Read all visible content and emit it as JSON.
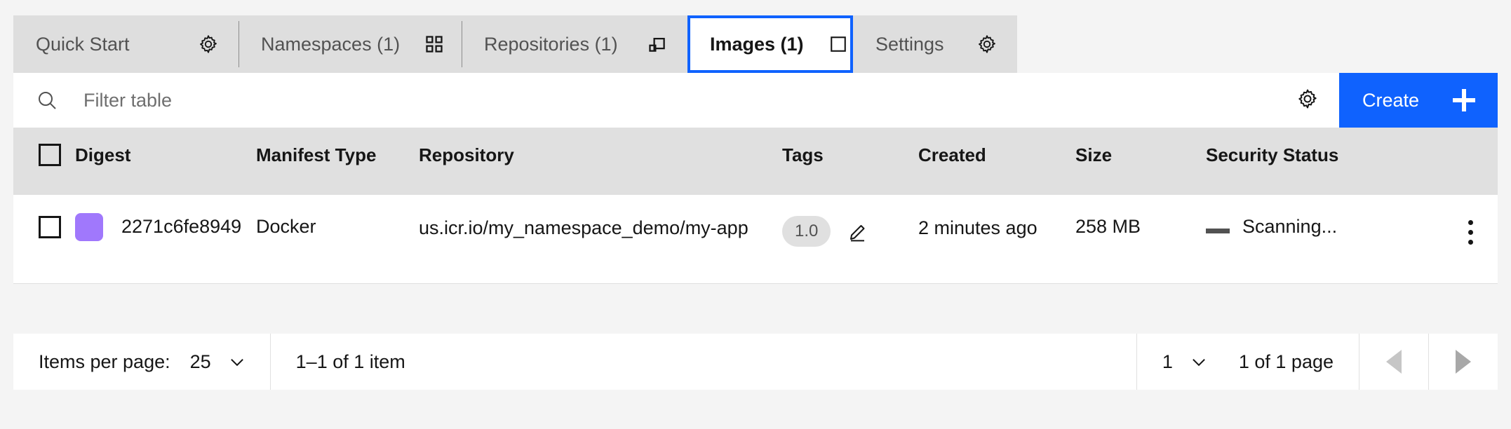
{
  "colors": {
    "accent": "#0f62fe",
    "tab_bg": "#dedede",
    "tab_selected_bg": "#ffffff",
    "page_bg": "#f4f4f4",
    "table_header_bg": "#e0e0e0",
    "image_swatch": "#a078fc",
    "tag_pill_bg": "#e0e0e0",
    "scanning_dash": "#525252"
  },
  "tabs": [
    {
      "label": "Quick Start",
      "icon": "gear-icon",
      "selected": false
    },
    {
      "label": "Namespaces (1)",
      "icon": "grid-2x2-icon",
      "selected": false
    },
    {
      "label": "Repositories (1)",
      "icon": "group-copy-icon",
      "selected": false
    },
    {
      "label": "Images (1)",
      "icon": "square-icon",
      "selected": true
    },
    {
      "label": "Settings",
      "icon": "gear-icon",
      "selected": false
    }
  ],
  "toolbar": {
    "search_placeholder": "Filter table",
    "search_value": "",
    "search_icon": "search-icon",
    "settings_icon": "gear-icon",
    "create_label": "Create",
    "create_icon": "plus-icon"
  },
  "table": {
    "select_all_checked": false,
    "columns": [
      {
        "key": "digest",
        "label": "Digest"
      },
      {
        "key": "mtype",
        "label": "Manifest Type"
      },
      {
        "key": "repo",
        "label": "Repository"
      },
      {
        "key": "tags",
        "label": "Tags"
      },
      {
        "key": "created",
        "label": "Created"
      },
      {
        "key": "size",
        "label": "Size"
      },
      {
        "key": "security",
        "label": "Security Status"
      }
    ],
    "rows": [
      {
        "checked": false,
        "swatch_icon": "image-color-swatch",
        "digest": "2271c6fe8949",
        "mtype": "Docker",
        "repo": "us.icr.io/my_namespace_demo/my-app",
        "tag": "1.0",
        "tag_edit_icon": "pencil-edit-icon",
        "created": "2 minutes ago",
        "size": "258 MB",
        "security_icon": "dash-icon",
        "security": "Scanning...",
        "overflow_icon": "overflow-menu-vertical-icon"
      }
    ]
  },
  "pagination": {
    "items_per_page_label": "Items per page:",
    "items_per_page_value": "25",
    "range_text": "1–1 of 1 item",
    "page_value": "1",
    "page_label": "1 of 1 page",
    "prev_icon": "caret-left-icon",
    "next_icon": "caret-right-icon",
    "chevron_icon": "chevron-down-icon"
  }
}
